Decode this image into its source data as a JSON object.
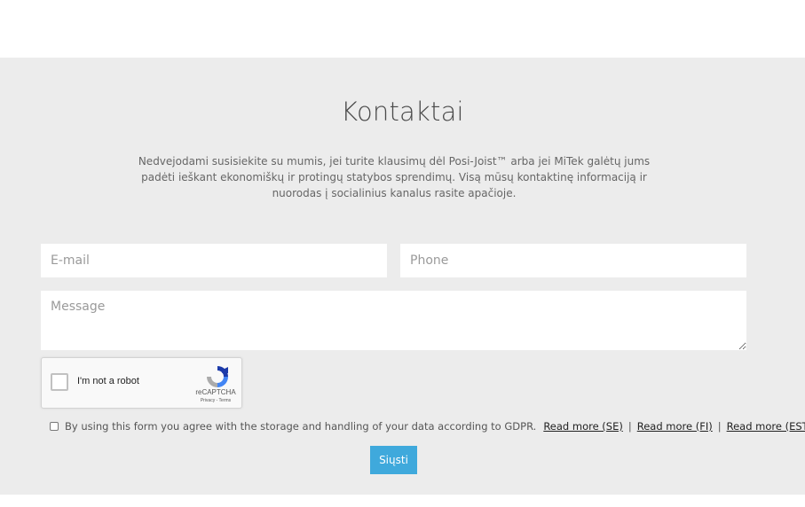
{
  "section": {
    "title": "Kontaktai",
    "intro": "Nedvejodami susisiekite su mumis, jei turite klausimų dėl Posi-Joist™ arba jei MiTek galėtų jums padėti ieškant ekonomiškų ir protingų statybos sprendimų. Visą mūsų kontaktinę informaciją ir nuorodas į socialinius kanalus rasite apačioje."
  },
  "form": {
    "email_placeholder": "E-mail",
    "phone_placeholder": "Phone",
    "message_placeholder": "Message",
    "submit_label": "Siųsti"
  },
  "recaptcha": {
    "label": "I'm not a robot",
    "brand": "reCAPTCHA",
    "links": "Privacy - Terms"
  },
  "gdpr": {
    "text": "By using this form you agree with the storage and handling of your data according to GDPR.",
    "links": [
      "Read more (SE)",
      "Read more (FI)",
      "Read more (EST)"
    ],
    "separator": "|"
  },
  "colors": {
    "section_bg": "#ececec",
    "submit_bg": "#3fa9dc"
  },
  "icons": {
    "recaptcha_logo": "recaptcha-logo-icon",
    "resize_grip": "resize-grip-icon"
  }
}
